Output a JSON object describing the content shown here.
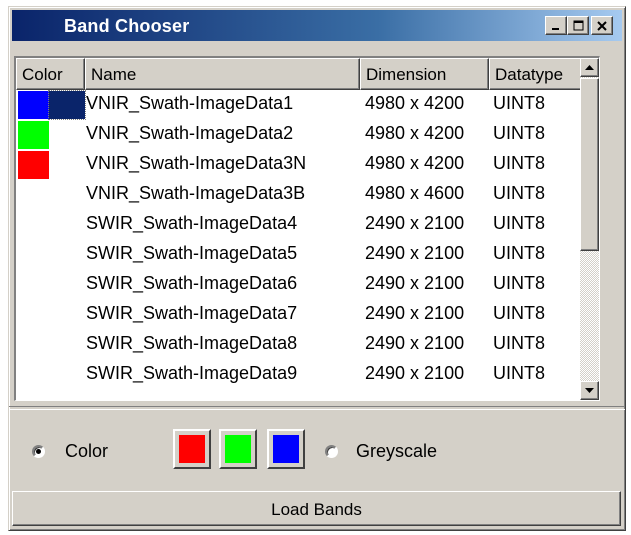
{
  "window": {
    "title": "Band Chooser"
  },
  "table": {
    "columns": [
      "Color",
      "Name",
      "Dimension",
      "Datatype"
    ],
    "rows": [
      {
        "color": "#0000ff",
        "name": "VNIR_Swath-ImageData1",
        "dimension": "4980 x 4200",
        "datatype": "UINT8",
        "selected": true
      },
      {
        "color": "#00ff00",
        "name": "VNIR_Swath-ImageData2",
        "dimension": "4980 x 4200",
        "datatype": "UINT8"
      },
      {
        "color": "#ff0000",
        "name": "VNIR_Swath-ImageData3N",
        "dimension": "4980 x 4200",
        "datatype": "UINT8"
      },
      {
        "color": "",
        "name": "VNIR_Swath-ImageData3B",
        "dimension": "4980 x 4600",
        "datatype": "UINT8"
      },
      {
        "color": "",
        "name": "SWIR_Swath-ImageData4",
        "dimension": "2490 x 2100",
        "datatype": "UINT8"
      },
      {
        "color": "",
        "name": "SWIR_Swath-ImageData5",
        "dimension": "2490 x 2100",
        "datatype": "UINT8"
      },
      {
        "color": "",
        "name": "SWIR_Swath-ImageData6",
        "dimension": "2490 x 2100",
        "datatype": "UINT8"
      },
      {
        "color": "",
        "name": "SWIR_Swath-ImageData7",
        "dimension": "2490 x 2100",
        "datatype": "UINT8"
      },
      {
        "color": "",
        "name": "SWIR_Swath-ImageData8",
        "dimension": "2490 x 2100",
        "datatype": "UINT8"
      },
      {
        "color": "",
        "name": "SWIR_Swath-ImageData9",
        "dimension": "2490 x 2100",
        "datatype": "UINT8"
      }
    ]
  },
  "mode": {
    "color_label": "Color",
    "greyscale_label": "Greyscale",
    "selected": "Color",
    "channels": [
      {
        "name": "red",
        "color": "#ff0000"
      },
      {
        "name": "green",
        "color": "#00ff00"
      },
      {
        "name": "blue",
        "color": "#0000ff"
      }
    ]
  },
  "actions": {
    "load_label": "Load Bands"
  }
}
